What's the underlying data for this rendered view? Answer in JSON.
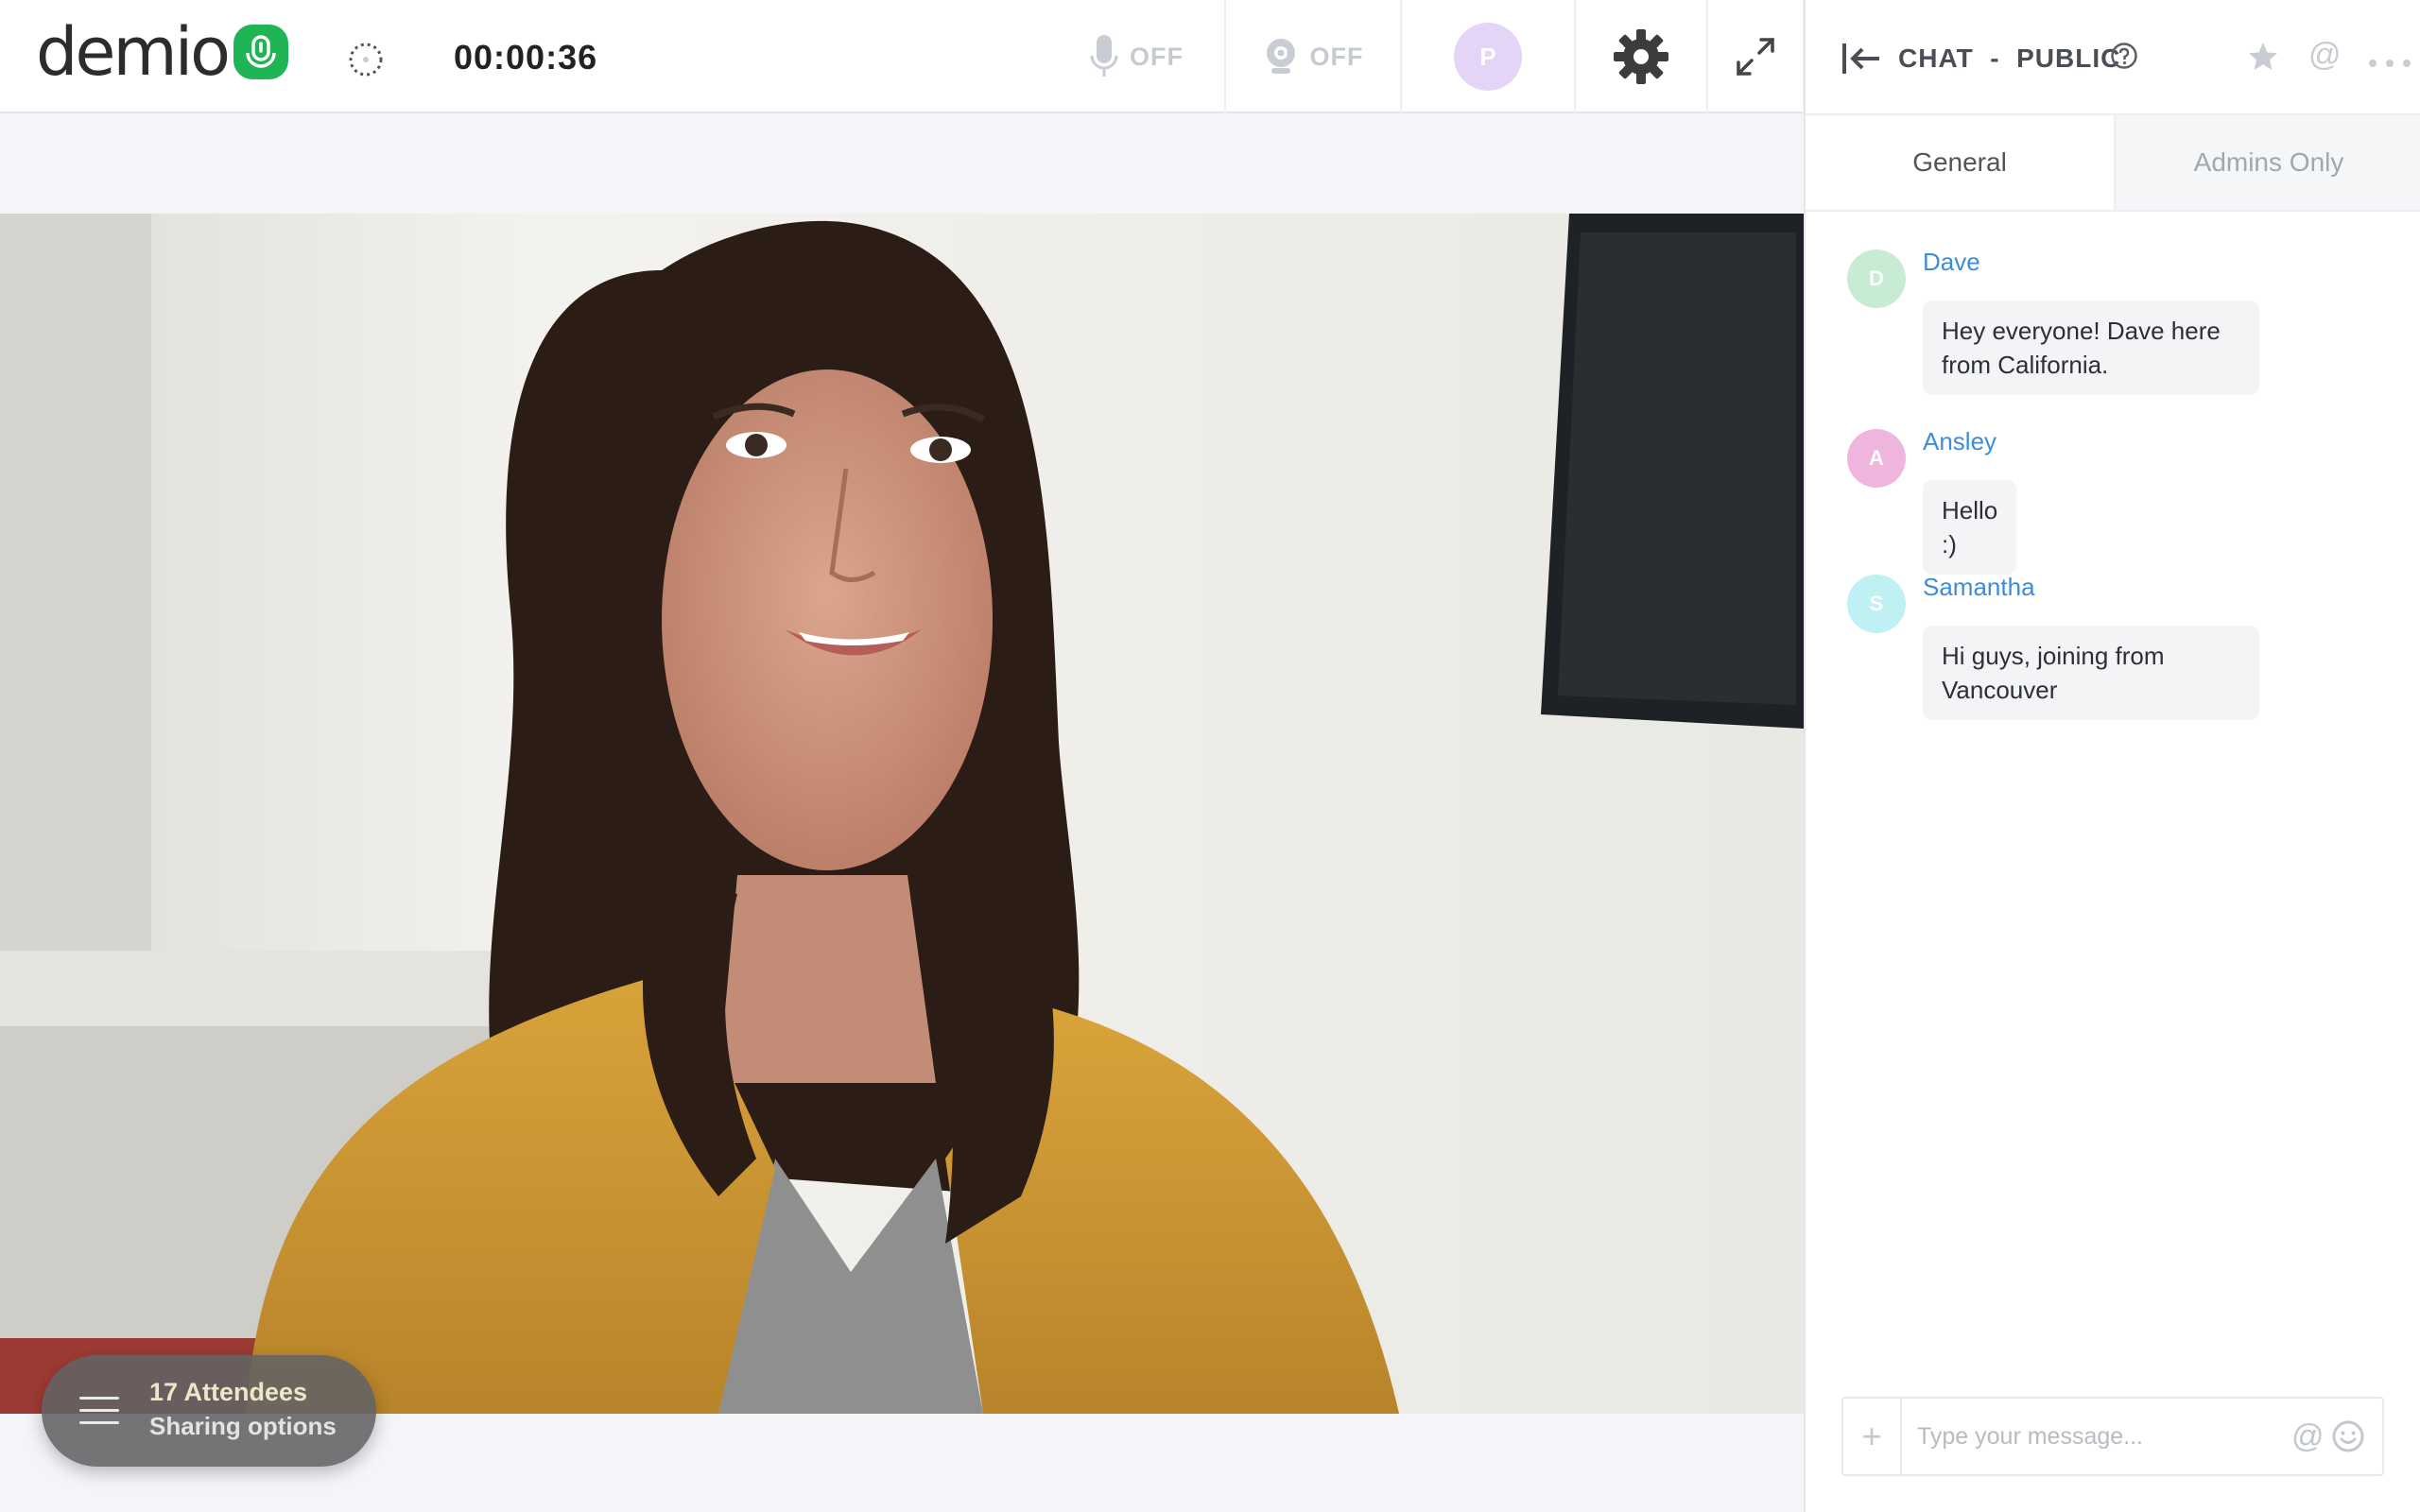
{
  "app": {
    "brand": "demio"
  },
  "topbar": {
    "timer": "00:00:36",
    "mic_status": "OFF",
    "cam_status": "OFF",
    "presenter_initial": "P"
  },
  "attendees": {
    "count_label": "17 Attendees",
    "sharing_label": "Sharing options"
  },
  "chat": {
    "title": "CHAT  -  PUBLIC",
    "tabs": [
      {
        "label": "General",
        "active": true
      },
      {
        "label": "Admins Only",
        "active": false
      }
    ],
    "messages": [
      {
        "initial": "D",
        "name": "Dave",
        "text_lines": [
          "Hey everyone! Dave here",
          "from California."
        ],
        "avatar_color": "#c8ecd3"
      },
      {
        "initial": "A",
        "name": "Ansley",
        "text_lines": [
          "Hello :)"
        ],
        "avatar_color": "#eeb6dd"
      },
      {
        "initial": "S",
        "name": "Samantha",
        "text_lines": [
          "Hi guys, joining from",
          "Vancouver"
        ],
        "avatar_color": "#bff0f4"
      }
    ],
    "composer": {
      "placeholder": "Type your message...",
      "add_icon": "plus-icon",
      "mention_icon": "at-icon",
      "emoji_icon": "smiley-icon"
    }
  },
  "colors": {
    "brand_green": "#1fb454",
    "link_blue": "#3d8cd9",
    "muted": "#c6cad1"
  }
}
